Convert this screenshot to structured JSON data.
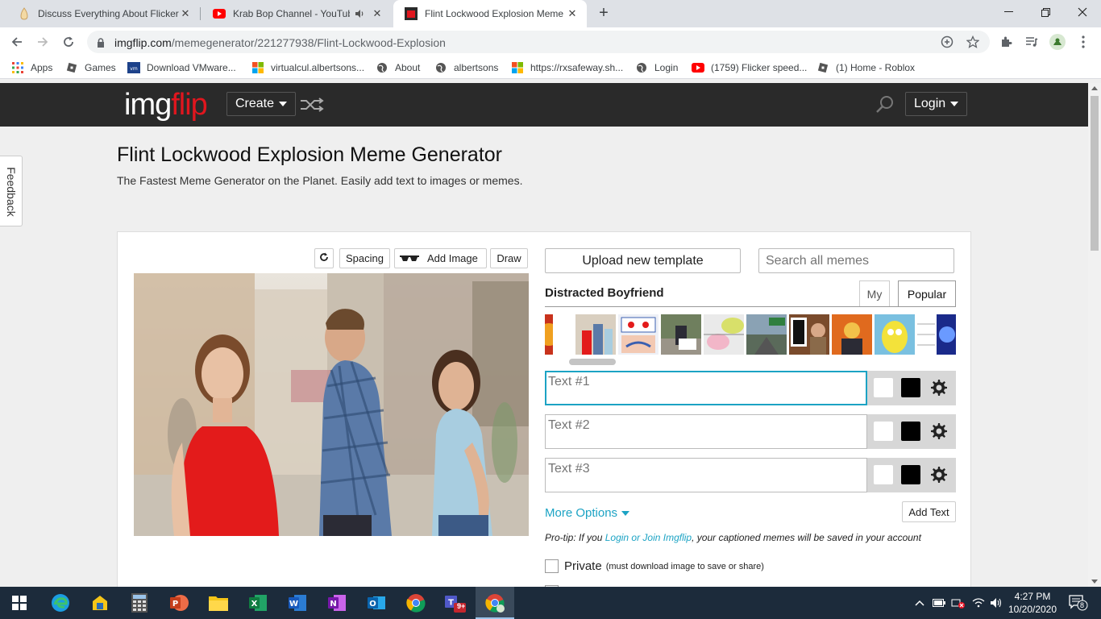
{
  "browser": {
    "tabs": [
      {
        "title": "Discuss Everything About Flicker",
        "active": false
      },
      {
        "title": "Krab Bop Channel - YouTube",
        "active": false
      },
      {
        "title": "Flint Lockwood Explosion Meme",
        "active": true
      }
    ],
    "url_domain": "imgflip.com",
    "url_path": "/memegenerator/221277938/Flint-Lockwood-Explosion",
    "bookmarks": [
      {
        "label": "Apps"
      },
      {
        "label": "Games"
      },
      {
        "label": "Download VMware..."
      },
      {
        "label": "virtualcul.albertsons..."
      },
      {
        "label": "About"
      },
      {
        "label": "albertsons"
      },
      {
        "label": "https://rxsafeway.sh..."
      },
      {
        "label": "Login"
      },
      {
        "label": "(1759) Flicker speed..."
      },
      {
        "label": "(1) Home - Roblox"
      }
    ]
  },
  "site": {
    "logo_part1": "img",
    "logo_part2": "flip",
    "create_label": "Create",
    "login_label": "Login",
    "feedback_label": "Feedback"
  },
  "page": {
    "title": "Flint Lockwood Explosion Meme Generator",
    "subtitle": "The Fastest Meme Generator on the Planet. Easily add text to images or memes."
  },
  "editor": {
    "spacing_label": "Spacing",
    "add_image_label": "Add Image",
    "draw_label": "Draw",
    "upload_label": "Upload new template",
    "search_placeholder": "Search all memes",
    "template_name": "Distracted Boyfriend",
    "tab_my": "My",
    "tab_popular": "Popular",
    "text_boxes": [
      {
        "placeholder": "Text #1"
      },
      {
        "placeholder": "Text #2"
      },
      {
        "placeholder": "Text #3"
      }
    ],
    "more_options": "More Options",
    "add_text": "Add Text",
    "protip_prefix": "Pro-tip: If you",
    "protip_link": "Login or Join Imgflip",
    "protip_suffix": ", your captioned memes will be saved in your account",
    "private_label": "Private",
    "private_note": "(must download image to save or share)"
  },
  "taskbar": {
    "time": "4:27 PM",
    "date": "10/20/2020",
    "notification_count": "8",
    "teams_badge": "9+"
  },
  "colors": {
    "accent": "#1ca3c4",
    "brand_red": "#e0161e",
    "header_bg": "#2a2a2a"
  }
}
